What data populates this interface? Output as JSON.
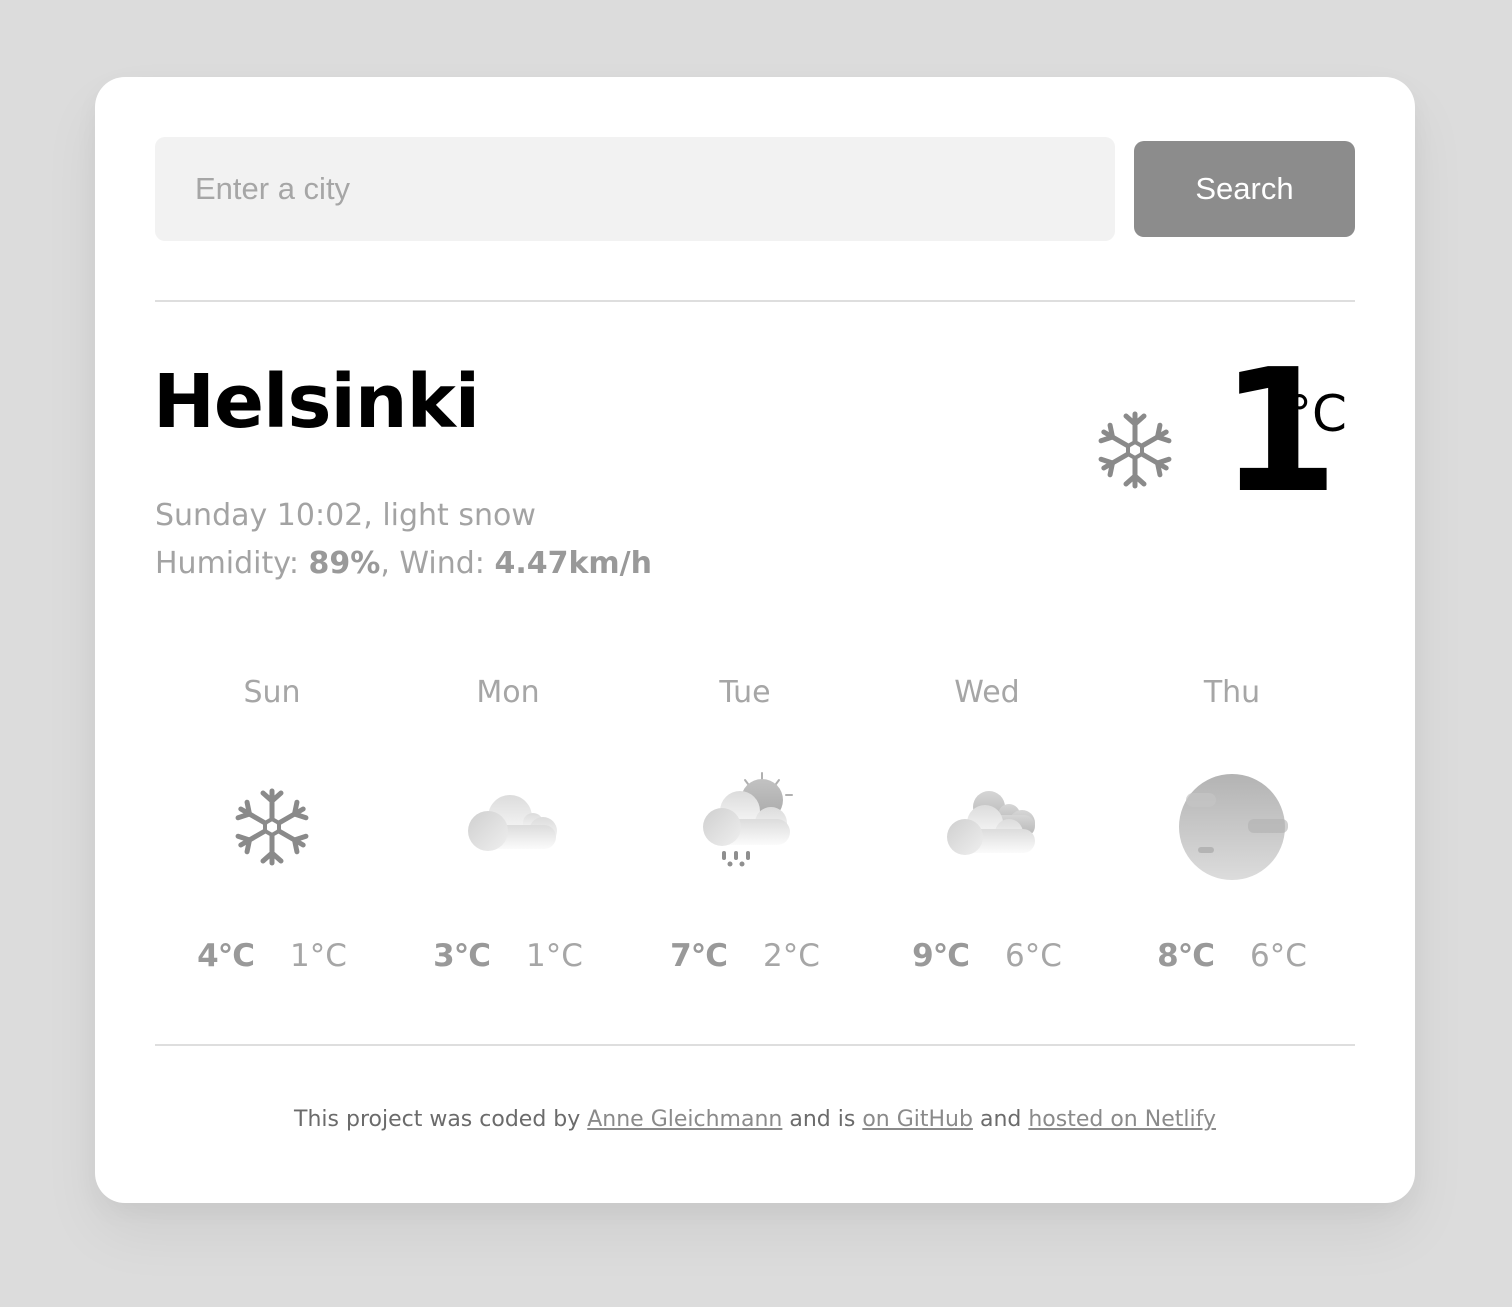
{
  "search": {
    "placeholder": "Enter a city",
    "value": "",
    "button_label": "Search"
  },
  "current": {
    "city": "Helsinki",
    "day_time": "Sunday 10:02",
    "description": "light snow",
    "humidity_label": "Humidity:",
    "humidity": "89%",
    "wind_label": "Wind:",
    "wind": "4.47km/h",
    "temperature": "1",
    "unit": "°C",
    "icon": "snowflake-icon"
  },
  "forecast": [
    {
      "day": "Sun",
      "icon": "snowflake-icon",
      "max": "4°C",
      "min": "1°C"
    },
    {
      "day": "Mon",
      "icon": "cloud-icon",
      "max": "3°C",
      "min": "1°C"
    },
    {
      "day": "Tue",
      "icon": "sun-cloud-rain-icon",
      "max": "7°C",
      "min": "2°C"
    },
    {
      "day": "Wed",
      "icon": "broken-clouds-icon",
      "max": "9°C",
      "min": "6°C"
    },
    {
      "day": "Thu",
      "icon": "mist-icon",
      "max": "8°C",
      "min": "6°C"
    }
  ],
  "footer": {
    "text1": "This project was coded by ",
    "author_link": "Anne Gleichmann",
    "text2": " and is ",
    "github_link": "on GitHub",
    "text3": " and ",
    "netlify_link": "hosted on Netlify"
  },
  "colors": {
    "background": "#dcdcdc",
    "card": "#ffffff",
    "input_bg": "#f2f2f2",
    "button_bg": "#8c8c8c",
    "muted_text": "#a6a6a6"
  }
}
